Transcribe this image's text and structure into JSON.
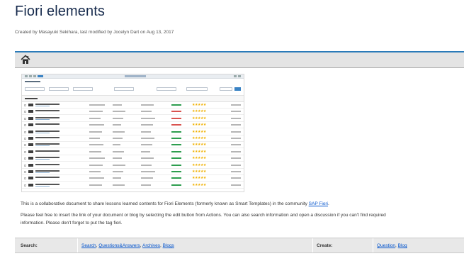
{
  "page": {
    "title": "Fiori elements",
    "byline": "Created by Masayuki Sekihara, last modified by Jocelyn Dart on Aug 13, 2017"
  },
  "home_bar": {
    "icon": "home-icon"
  },
  "screenshot": {
    "row_count": 13,
    "statuses": [
      "#2e9e4f",
      "#d9534f",
      "#d9534f",
      "#d9534f",
      "#2e9e4f",
      "#2e9e4f",
      "#2e9e4f",
      "#2e9e4f",
      "#2e9e4f",
      "#2e9e4f",
      "#2e9e4f",
      "#2e9e4f",
      "#2e9e4f"
    ]
  },
  "intro": {
    "text_before": "This is a collaborative document to share lessons learned contents for Fiori Elements (formerly known as Smart Templates) in the community ",
    "link": "SAP Fiori",
    "text_after": "."
  },
  "instructions": {
    "line1": "Please feel free to insert the link of your document or blog by selecting the edit button from Actions. You can also search information and open a discussion if you can't find required",
    "line2": "information. Please don't forget to put the tag fiori."
  },
  "info_table": {
    "search_label": "Search:",
    "search_links": [
      "Search",
      "Questions&Answers",
      "Archives",
      "Blogs"
    ],
    "create_label": "Create:",
    "create_links": [
      "Question",
      "Blog"
    ]
  },
  "colors": {
    "accent": "#2b7bb9",
    "link": "#0052cc",
    "title": "#172b4d"
  }
}
